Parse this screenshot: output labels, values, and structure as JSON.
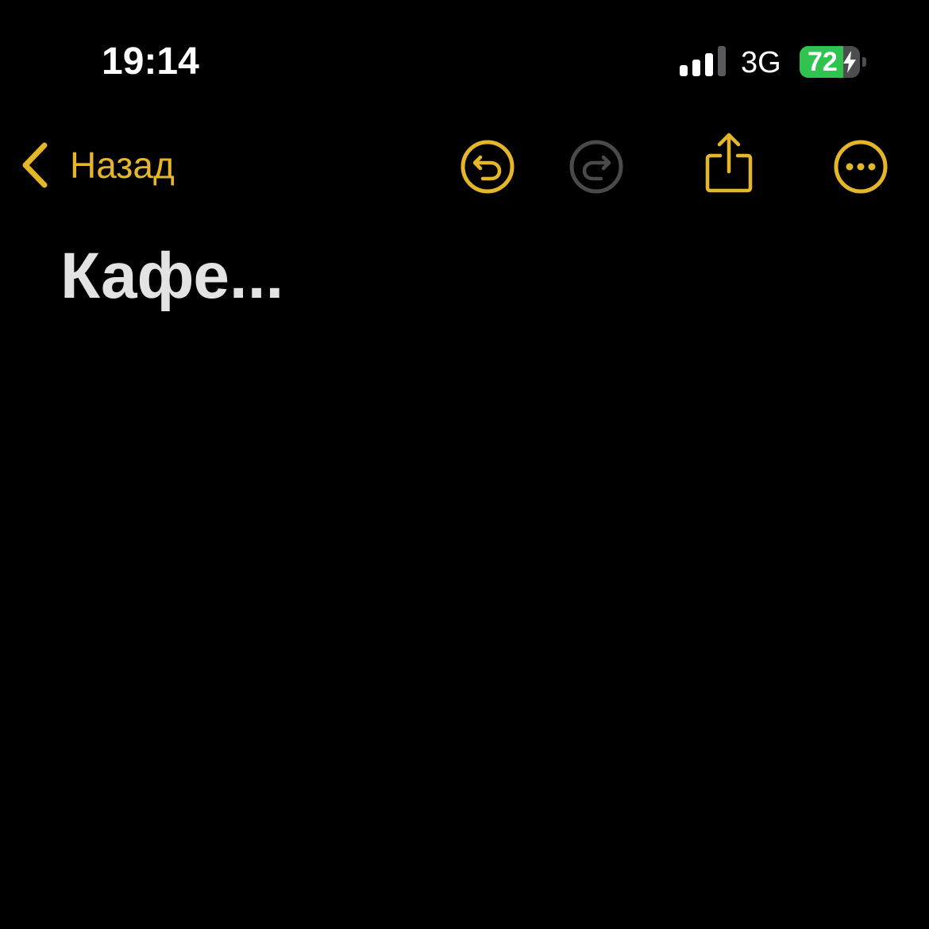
{
  "status_bar": {
    "time": "19:14",
    "network": "3G",
    "battery_percent": 72,
    "battery_label": "72",
    "charging": true
  },
  "nav": {
    "back_label": "Назад",
    "icons": {
      "back": "chevron-left-icon",
      "undo": "undo-icon",
      "redo": "redo-icon",
      "share": "share-icon",
      "more": "more-icon"
    }
  },
  "note": {
    "title": "Кафе..."
  },
  "colors": {
    "background": "#000000",
    "accent": "#e5b628",
    "disabled": "#4a4a4c",
    "title": "#e3e3e3",
    "battery_green": "#30c44f"
  }
}
